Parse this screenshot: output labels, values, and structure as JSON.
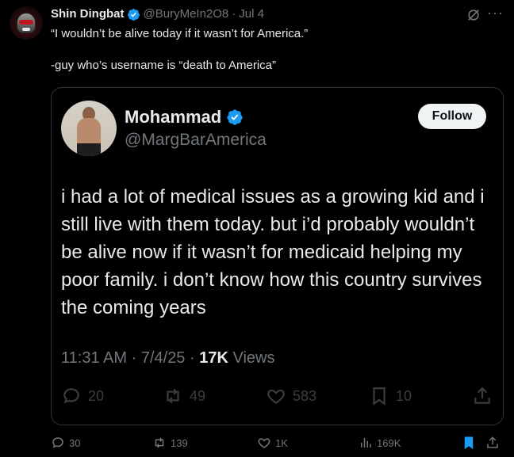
{
  "tweet": {
    "author_name": "Shin Dingbat",
    "author_handle": "@BuryMeIn2O8",
    "separator": "·",
    "date": "Jul 4",
    "text": "“I wouldn’t be alive today if it wasn’t for America.”\n\n-guy who’s username is “death to America”",
    "stats": {
      "replies": "30",
      "reposts": "139",
      "likes": "1K",
      "views": "169K"
    }
  },
  "quote": {
    "author_name": "Mohammad",
    "author_handle": "@MargBarAmerica",
    "follow_label": "Follow",
    "text": "i had a lot of medical issues as a growing kid and i still live with them today. but i’d probably wouldn’t be alive now if it wasn’t for medicaid helping my poor family. i don’t know how this country survives the coming years",
    "time": "11:31 AM",
    "date": "7/4/25",
    "views_count": "17K",
    "views_label": "Views",
    "dot": "·",
    "stats": {
      "replies": "20",
      "reposts": "49",
      "likes": "583",
      "bookmarks": "10"
    }
  },
  "colors": {
    "background": "#000000",
    "text": "#e7e9ea",
    "muted": "#71767b",
    "verified": "#1d9bf0",
    "bookmarked": "#1d9bf0",
    "border": "#2f3336"
  },
  "icons": [
    "verified-badge-icon",
    "grok-icon",
    "more-icon",
    "reply-icon",
    "repost-icon",
    "like-icon",
    "bookmark-icon",
    "share-icon",
    "views-icon"
  ]
}
